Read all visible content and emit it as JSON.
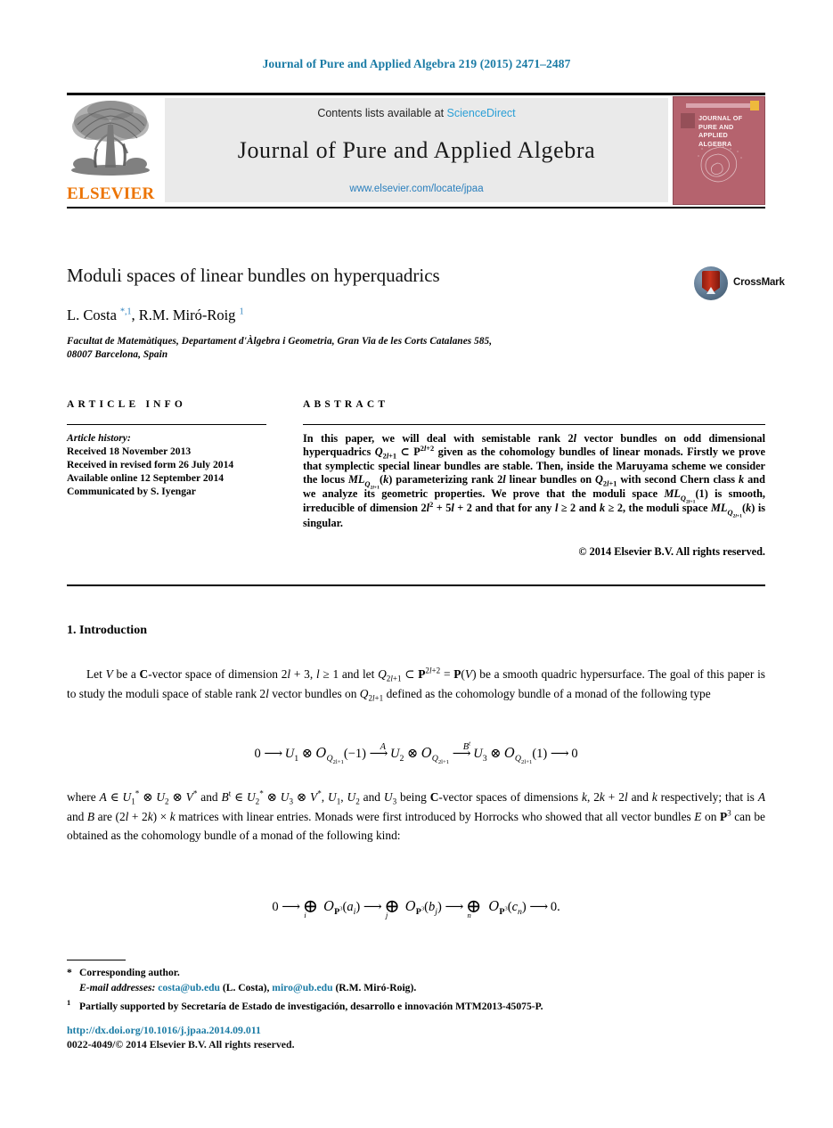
{
  "running_head": "Journal of Pure and Applied Algebra 219 (2015) 2471–2487",
  "masthead": {
    "publisher_wordmark": "ELSEVIER",
    "publisher_logo_icon": "elsevier-tree-icon",
    "contents_prefix": "Contents lists available at ",
    "contents_link": "ScienceDirect",
    "journal_title": "Journal of Pure and Applied Algebra",
    "journal_url": "www.elsevier.com/locate/jpaa",
    "cover": {
      "title_lines": "JOURNAL OF PURE AND APPLIED ALGEBRA",
      "background_color": "#b5636e",
      "accent_color": "#efb93c"
    }
  },
  "article": {
    "title": "Moduli spaces of linear bundles on hyperquadrics",
    "authors_html": "L. Costa <sup class=\"lnk\">*,1</sup>, R.M. Miró-Roig <sup class=\"lnk\">1</sup>",
    "affiliation_line1": "Facultat de Matemàtiques, Departament d'Àlgebra i Geometria, Gran Via de les Corts Catalanes 585,",
    "affiliation_line2": "08007 Barcelona, Spain",
    "crossmark_label": "CrossMark"
  },
  "columns": {
    "info_heading": "ARTICLE INFO",
    "abstract_heading": "ABSTRACT"
  },
  "history": {
    "label": "Article history:",
    "received": "Received 18 November 2013",
    "revised": "Received in revised form 26 July 2014",
    "available": "Available online 12 September 2014",
    "communicated": "Communicated by S. Iyengar"
  },
  "abstract": {
    "text_html": "In this paper, we will deal with semistable rank 2<span class=\"mi\">l</span> vector bundles on odd dimensional hyperquadrics <span class=\"mi\">Q</span><sub>2<span class=\"mi\">l</span>+1</sub> &#8834; <span class=\"mbb\">P</span><sup>2<span class=\"mi\">l</span>+2</sup> given as the cohomology bundles of linear monads. Firstly we prove that symplectic special linear bundles are stable. Then, inside the Maruyama scheme we consider the locus <span class=\"mi\">ML</span><sub><span class=\"mi\">Q</span><sub>2<span class=\"mi\">l</span>+1</sub></sub>(<span class=\"mi\">k</span>) parameterizing rank 2<span class=\"mi\">l</span> linear bundles on <span class=\"mi\">Q</span><sub>2<span class=\"mi\">l</span>+1</sub> with second Chern class <span class=\"mi\">k</span> and we analyze its geometric properties. We prove that the moduli space <span class=\"mi\">ML</span><sub><span class=\"mi\">Q</span><sub>2<span class=\"mi\">l</span>+1</sub></sub>(1) is smooth, irreducible of dimension 2<span class=\"mi\">l</span><sup>2</sup> + 5<span class=\"mi\">l</span> + 2 and that for any <span class=\"mi\">l</span> &#8805; 2 and <span class=\"mi\">k</span> &#8805; 2, the moduli space <span class=\"mi\">ML</span><sub><span class=\"mi\">Q</span><sub>2<span class=\"mi\">l</span>+1</sub></sub>(<span class=\"mi\">k</span>) is singular.",
    "copyright": "© 2014 Elsevier B.V. All rights reserved."
  },
  "body": {
    "section_heading": "1. Introduction",
    "paragraph1_html": "Let <span class=\"mi\">V</span> be a <span class=\"mbb\">C</span>-vector space of dimension 2<span class=\"mi\">l</span> + 3, <span class=\"mi\">l</span> &#8805; 1 and let <span class=\"mi\">Q</span><sub>2<span class=\"mi\">l</span>+1</sub> &#8834; <span class=\"mbb\">P</span><sup>2<span class=\"mi\">l</span>+2</sup> = <span class=\"mbb\">P</span>(<span class=\"mi\">V</span>) be a smooth quadric hypersurface. The goal of this paper is to study the moduli space of stable rank 2<span class=\"mi\">l</span> vector bundles on <span class=\"mi\">Q</span><sub>2<span class=\"mi\">l</span>+1</sub> defined as the cohomology bundle of a monad of the following type",
    "equation1_html": "0 <span class=\"arrow\">&#10230;</span> <span class=\"mi\">U</span><sub>1</sub> &#8855; <span class=\"cal\">O</span><sub><span class=\"mi\">Q</span><sub>2l+1</sub></sub>(&#8722;1) <span class=\"eqlabel\">A</span><span class=\"arrow\">&#10230;</span> <span class=\"mi\">U</span><sub>2</sub> &#8855; <span class=\"cal\">O</span><sub><span class=\"mi\">Q</span><sub>2l+1</sub></sub> <span class=\"eqlabel\">B<sup>t</sup></span><span class=\"arrow\">&#10230;</span> <span class=\"mi\">U</span><sub>3</sub> &#8855; <span class=\"cal\">O</span><sub><span class=\"mi\">Q</span><sub>2l+1</sub></sub>(1) <span class=\"arrow\">&#10230;</span> 0",
    "paragraph2_html": "where <span class=\"mi\">A</span> &#8712; <span class=\"mi\">U</span><sub>1</sub><sup>*</sup> &#8855; <span class=\"mi\">U</span><sub>2</sub> &#8855; <span class=\"mi\">V</span><sup>*</sup> and <span class=\"mi\">B</span><sup>t</sup> &#8712; <span class=\"mi\">U</span><sub>2</sub><sup>*</sup> &#8855; <span class=\"mi\">U</span><sub>3</sub> &#8855; <span class=\"mi\">V</span><sup>*</sup>, <span class=\"mi\">U</span><sub>1</sub>, <span class=\"mi\">U</span><sub>2</sub> and <span class=\"mi\">U</span><sub>3</sub> being <span class=\"mbb\">C</span>-vector spaces of dimensions <span class=\"mi\">k</span>, 2<span class=\"mi\">k</span> + 2<span class=\"mi\">l</span> and <span class=\"mi\">k</span> respectively; that is <span class=\"mi\">A</span> and <span class=\"mi\">B</span> are (2<span class=\"mi\">l</span> + 2<span class=\"mi\">k</span>) &#215; <span class=\"mi\">k</span> matrices with linear entries. Monads were first introduced by Horrocks who showed that all vector bundles <span class=\"mi\">E</span> on <span class=\"mbb\">P</span><sup>3</sup> can be obtained as the cohomology bundle of a monad of the following kind:",
    "equation2_html": "0 <span class=\"arrow\">&#10230;</span> <span class=\"bigoplus\">&#8853;</span><span class=\"idx\">i</span> <span class=\"cal\">O</span><sub><span class=\"mbb\">P</span><sup>3</sup></sub>(<span class=\"mi\">a<sub>i</sub></span>) <span class=\"arrow\">&#10230;</span> <span class=\"bigoplus\">&#8853;</span><span class=\"idx\">j</span> <span class=\"cal\">O</span><sub><span class=\"mbb\">P</span><sup>3</sup></sub>(<span class=\"mi\">b<sub>j</sub></span>) <span class=\"arrow\">&#10230;</span> <span class=\"bigoplus\">&#8853;</span><span class=\"idx\">n</span> <span class=\"cal\">O</span><sub><span class=\"mbb\">P</span><sup>3</sup></sub>(<span class=\"mi\">c<sub>n</sub></span>) <span class=\"arrow\">&#10230;</span> 0."
  },
  "footnotes": {
    "corresponding_mark": "*",
    "corresponding_text": "Corresponding author.",
    "email_label": "E-mail addresses:",
    "email1": "costa@ub.edu",
    "email1_owner": "(L. Costa),",
    "email2": "miro@ub.edu",
    "email2_owner": "(R.M. Miró-Roig).",
    "note_mark": "1",
    "note_text": "Partially supported by Secretaría de Estado de investigación, desarrollo e innovación MTM2013-45075-P.",
    "doi": "http://dx.doi.org/10.1016/j.jpaa.2014.09.011",
    "issn_copyright": "0022-4049/© 2014 Elsevier B.V. All rights reserved."
  }
}
